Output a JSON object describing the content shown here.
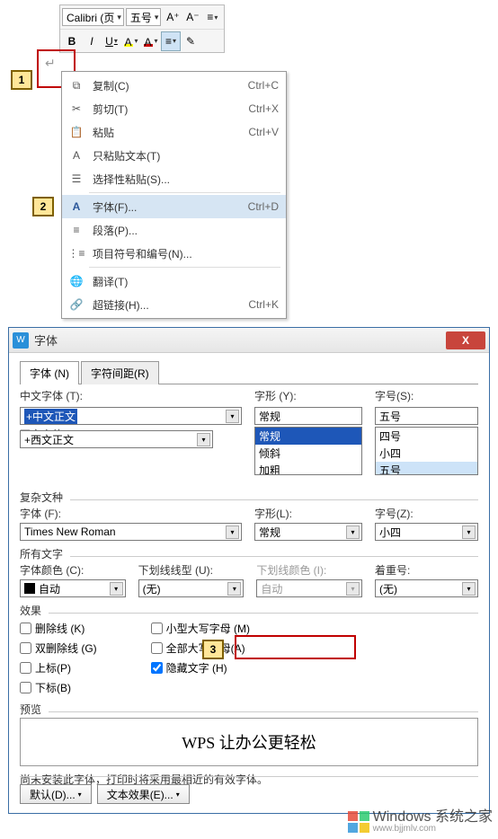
{
  "toolbar": {
    "font_name": "Calibri (页",
    "font_size": "五号",
    "a_plus": "A⁺",
    "a_minus": "A⁻",
    "bold": "B",
    "italic": "I",
    "underline": "U"
  },
  "callouts": {
    "one": "1",
    "two": "2",
    "three": "3"
  },
  "paragraph_mark": "↵",
  "menu": {
    "copy": {
      "label": "复制(C)",
      "shortcut": "Ctrl+C"
    },
    "cut": {
      "label": "剪切(T)",
      "shortcut": "Ctrl+X"
    },
    "paste": {
      "label": "粘贴",
      "shortcut": "Ctrl+V"
    },
    "paste_text": {
      "label": "只粘贴文本(T)",
      "shortcut": ""
    },
    "paste_special": {
      "label": "选择性粘贴(S)...",
      "shortcut": ""
    },
    "font": {
      "label": "字体(F)...",
      "shortcut": "Ctrl+D"
    },
    "paragraph": {
      "label": "段落(P)...",
      "shortcut": ""
    },
    "bullets": {
      "label": "项目符号和编号(N)...",
      "shortcut": ""
    },
    "translate": {
      "label": "翻译(T)",
      "shortcut": ""
    },
    "hyperlink": {
      "label": "超链接(H)...",
      "shortcut": "Ctrl+K"
    }
  },
  "dialog": {
    "title": "字体",
    "close": "X",
    "tabs": {
      "font": "字体 (N)",
      "spacing": "字符间距(R)"
    },
    "cn_font_label": "中文字体 (T):",
    "cn_font_value": "+中文正文",
    "style_label": "字形 (Y):",
    "style_value": "常规",
    "style_options": [
      "常规",
      "倾斜",
      "加粗"
    ],
    "size_label": "字号(S):",
    "size_value": "五号",
    "size_options": [
      "四号",
      "小四",
      "五号"
    ],
    "en_font_label": "西文字体 (X):",
    "en_font_value": "+西文正文",
    "complex_header": "复杂文种",
    "complex_font_label": "字体 (F):",
    "complex_font_value": "Times New Roman",
    "complex_style_label": "字形(L):",
    "complex_style_value": "常规",
    "complex_size_label": "字号(Z):",
    "complex_size_value": "小四",
    "all_text_header": "所有文字",
    "font_color_label": "字体颜色 (C):",
    "font_color_value": "自动",
    "underline_style_label": "下划线线型 (U):",
    "underline_style_value": "(无)",
    "underline_color_label": "下划线颜色 (I):",
    "underline_color_value": "自动",
    "emphasis_label": "着重号:",
    "emphasis_value": "(无)",
    "effects_header": "效果",
    "strike": "删除线 (K)",
    "dbl_strike": "双删除线 (G)",
    "superscript": "上标(P)",
    "subscript": "下标(B)",
    "small_caps": "小型大写字母 (M)",
    "all_caps": "全部大写字母(A)",
    "hidden": "隐藏文字 (H)",
    "preview_header": "预览",
    "preview_text": "WPS 让办公更轻松",
    "note": "尚未安装此字体，打印时将采用最相近的有效字体。",
    "default_btn": "默认(D)...",
    "text_effects_btn": "文本效果(E)..."
  },
  "watermark": {
    "title": "Windows 系统之家",
    "url": "www.bjjmlv.com"
  }
}
